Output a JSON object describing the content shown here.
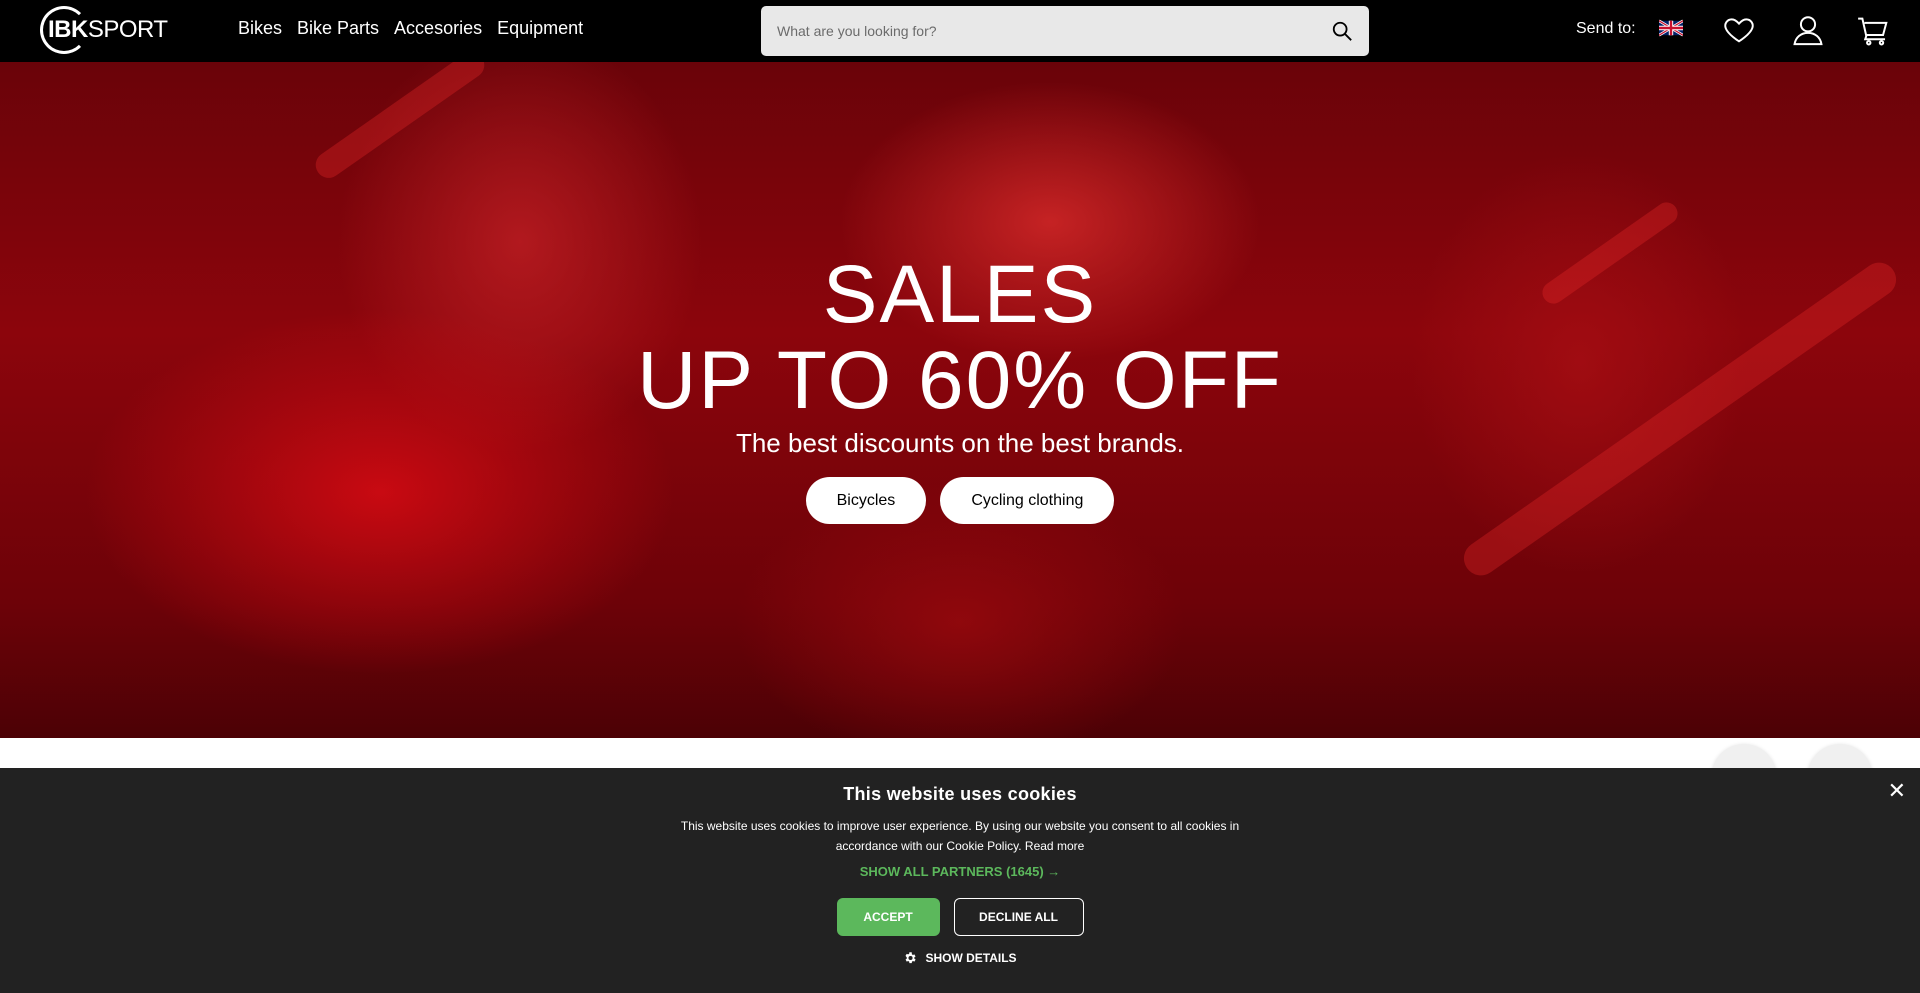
{
  "brand": {
    "logo_left": "IBK",
    "logo_right": "SPORT"
  },
  "nav": {
    "items": [
      "Bikes",
      "Bike Parts",
      "Accesories",
      "Equipment"
    ]
  },
  "search": {
    "placeholder": "What are you looking for?",
    "icon": "search-icon"
  },
  "header": {
    "send_to": "Send to:",
    "flag": "uk-flag-icon",
    "icons": [
      "heart-icon",
      "user-icon",
      "cart-icon"
    ]
  },
  "hero": {
    "title_line1": "SALES",
    "title_line2": "UP TO 60% OFF",
    "subtitle": "The best discounts on the best brands.",
    "buttons": [
      "Bicycles",
      "Cycling clothing"
    ],
    "accent": "#8c050c"
  },
  "cookies": {
    "title": "This website uses cookies",
    "text": "This website uses cookies to improve user experience. By using our website you consent to all cookies in accordance with our Cookie Policy.",
    "read_more": "Read more",
    "partners": "SHOW ALL PARTNERS (1645) →",
    "accept": "ACCEPT",
    "decline": "DECLINE ALL",
    "details": "SHOW DETAILS",
    "accent": "#5cb85c"
  }
}
